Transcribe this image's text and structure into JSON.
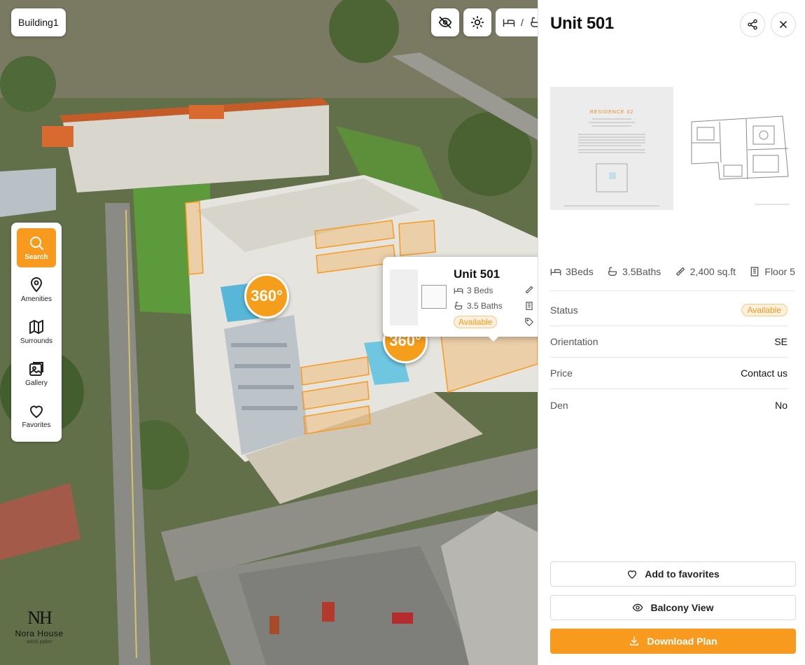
{
  "scene": {
    "building_label": "Building1",
    "badge_360": "360°",
    "filter_separator": "/"
  },
  "side_nav": [
    {
      "label": "Search",
      "icon": "search-icon",
      "active": true
    },
    {
      "label": "Amenities",
      "icon": "location-pin-icon",
      "active": false
    },
    {
      "label": "Surrounds",
      "icon": "map-icon",
      "active": false
    },
    {
      "label": "Gallery",
      "icon": "gallery-icon",
      "active": false
    },
    {
      "label": "Favorites",
      "icon": "heart-icon",
      "active": false
    }
  ],
  "popup": {
    "title": "Unit 501",
    "beds": "3 Beds",
    "baths": "3.5 Baths",
    "status": "Available"
  },
  "logo": {
    "mark": "NH",
    "name": "Nora House",
    "sub": "west palm"
  },
  "panel": {
    "title": "Unit 501",
    "floorplan_heading": "RESIDENCE 02",
    "specs": {
      "beds": "3Beds",
      "baths": "3.5Baths",
      "area": "2,400 sq.ft",
      "floor": "Floor 5"
    },
    "properties": [
      {
        "key": "Status",
        "value": "Available"
      },
      {
        "key": "Orientation",
        "value": "SE"
      },
      {
        "key": "Price",
        "value": "Contact us"
      },
      {
        "key": "Den",
        "value": "No"
      }
    ],
    "actions": {
      "favorites": "Add to favorites",
      "balcony": "Balcony View",
      "download": "Download Plan"
    }
  },
  "colors": {
    "accent": "#f79a1e",
    "status_bg": "#fdf0dd"
  }
}
